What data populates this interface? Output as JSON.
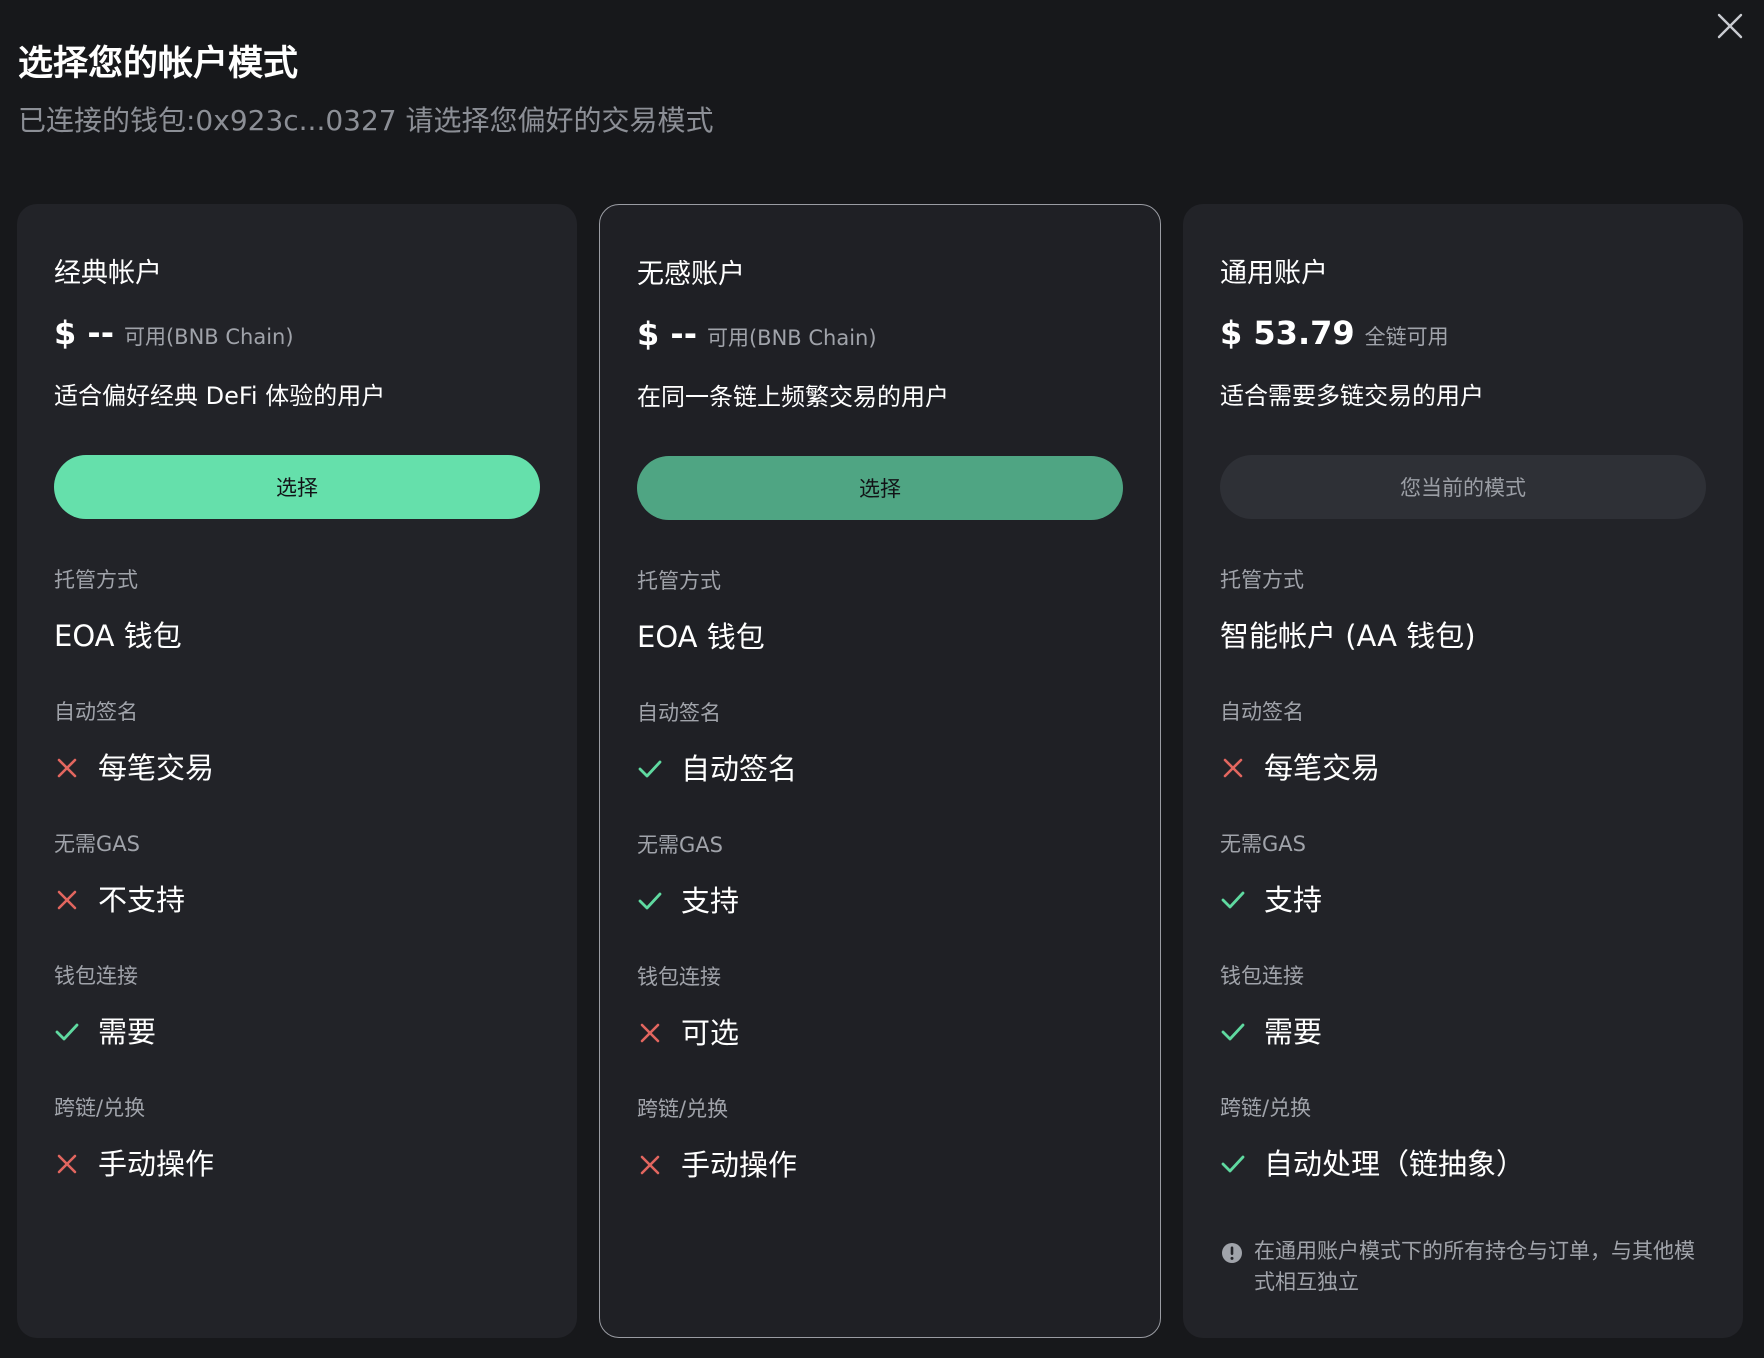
{
  "header": {
    "title": "选择您的帐户模式",
    "subtitle": "已连接的钱包:0x923c...0327 请选择您偏好的交易模式"
  },
  "close_icon": "close-icon",
  "colors": {
    "background": "#17181b",
    "card": "#222328",
    "accent": "#65e0ab",
    "accent_dim": "#4fa583",
    "check": "#5fd9a0",
    "cross": "#e2665f"
  },
  "labels": {
    "custody": "托管方式",
    "auto_sign": "自动签名",
    "no_gas": "无需GAS",
    "wallet_connect": "钱包连接",
    "cross_chain": "跨链/兑换"
  },
  "cards": [
    {
      "title": "经典帐户",
      "balance": "$ --",
      "balance_note": "可用(BNB Chain)",
      "desc": "适合偏好经典 DeFi 体验的用户",
      "button": "选择",
      "custody": "EOA 钱包",
      "auto_sign": {
        "status": "cross",
        "text": "每笔交易"
      },
      "no_gas": {
        "status": "cross",
        "text": "不支持"
      },
      "wallet_connect": {
        "status": "check",
        "text": "需要"
      },
      "cross_chain": {
        "status": "cross",
        "text": "手动操作"
      }
    },
    {
      "title": "无感账户",
      "balance": "$ --",
      "balance_note": "可用(BNB Chain)",
      "desc": "在同一条链上频繁交易的用户",
      "button": "选择",
      "custody": "EOA 钱包",
      "auto_sign": {
        "status": "check",
        "text": "自动签名"
      },
      "no_gas": {
        "status": "check",
        "text": "支持"
      },
      "wallet_connect": {
        "status": "cross",
        "text": "可选"
      },
      "cross_chain": {
        "status": "cross",
        "text": "手动操作"
      }
    },
    {
      "title": "通用账户",
      "balance": "$ 53.79",
      "balance_note": "全链可用",
      "desc": "适合需要多链交易的用户",
      "button": "您当前的模式",
      "custody": "智能帐户 (AA 钱包)",
      "auto_sign": {
        "status": "cross",
        "text": "每笔交易"
      },
      "no_gas": {
        "status": "check",
        "text": "支持"
      },
      "wallet_connect": {
        "status": "check",
        "text": "需要"
      },
      "cross_chain": {
        "status": "check",
        "text": "自动处理（链抽象）"
      },
      "note": "在通用账户模式下的所有持仓与订单，与其他模式相互独立"
    }
  ]
}
